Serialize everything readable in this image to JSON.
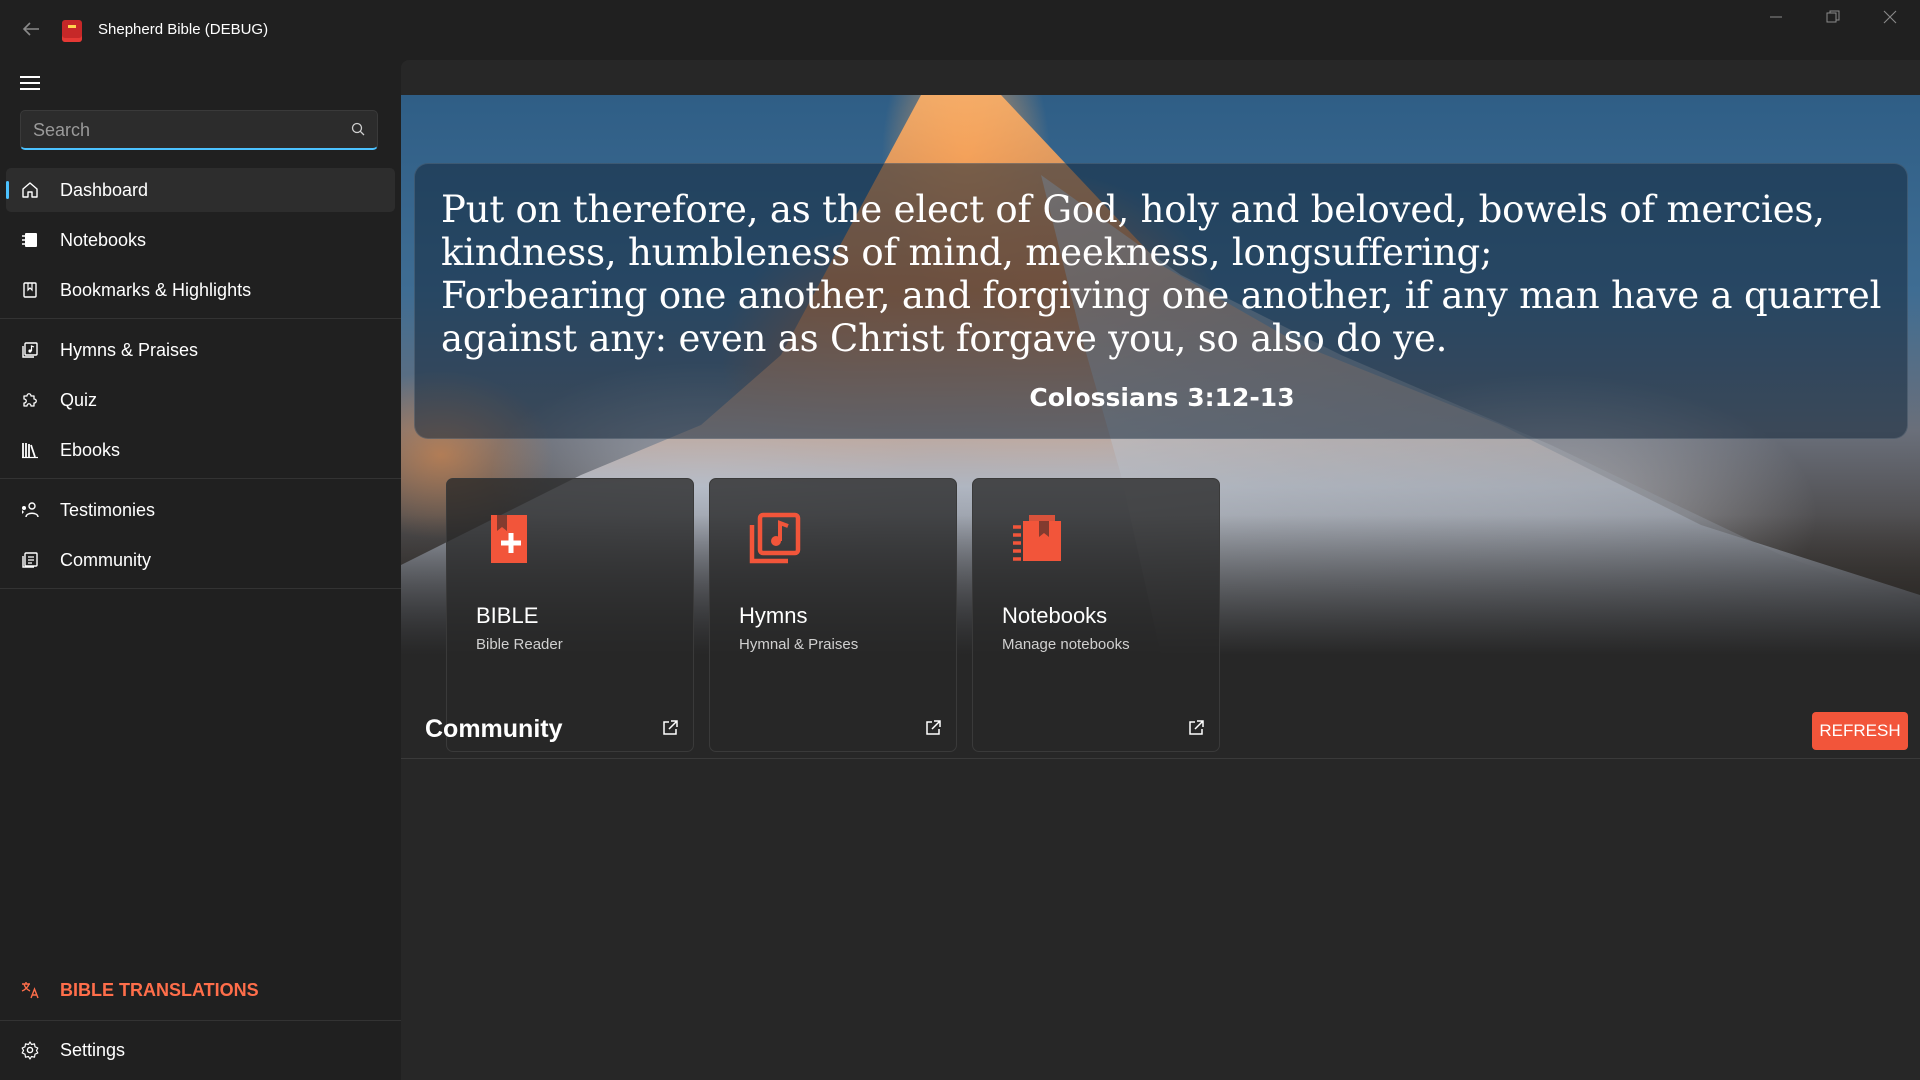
{
  "window": {
    "title": "Shepherd Bible (DEBUG)",
    "controls": [
      "minimize-icon",
      "restore-icon",
      "close-icon"
    ]
  },
  "sidebar": {
    "search": {
      "placeholder": "Search",
      "value": ""
    },
    "items": [
      {
        "label": "Dashboard",
        "icon": "home-icon",
        "active": true
      },
      {
        "label": "Notebooks",
        "icon": "notebook-icon"
      },
      {
        "label": "Bookmarks & Highlights",
        "icon": "bookmark-icon"
      },
      {
        "label": "Hymns & Praises",
        "icon": "music-book-icon"
      },
      {
        "label": "Quiz",
        "icon": "puzzle-icon"
      },
      {
        "label": "Ebooks",
        "icon": "library-icon"
      },
      {
        "label": "Testimonies",
        "icon": "people-icon"
      },
      {
        "label": "Community",
        "icon": "news-icon"
      }
    ],
    "translations_label": "BIBLE TRANSLATIONS",
    "settings_label": "Settings"
  },
  "verse": {
    "lines": [
      "Put on therefore, as the elect of God, holy and beloved, bowels of mercies, kindness, humbleness of mind, meekness, longsuffering;",
      "Forbearing one another, and forgiving one another, if any man have a quarrel against any: even as Christ forgave you, so also do ye."
    ],
    "reference": "Colossians 3:12-13"
  },
  "tiles": [
    {
      "title": "BIBLE",
      "subtitle": "Bible Reader",
      "icon": "bible-add-icon"
    },
    {
      "title": "Hymns",
      "subtitle": "Hymnal & Praises",
      "icon": "music-library-icon"
    },
    {
      "title": "Notebooks",
      "subtitle": "Manage notebooks",
      "icon": "notebook-stack-icon"
    }
  ],
  "community": {
    "title": "Community",
    "refresh_label": "REFRESH"
  },
  "colors": {
    "accent": "#4cc2ff",
    "brand": "#f2553a",
    "background": "#202020"
  }
}
